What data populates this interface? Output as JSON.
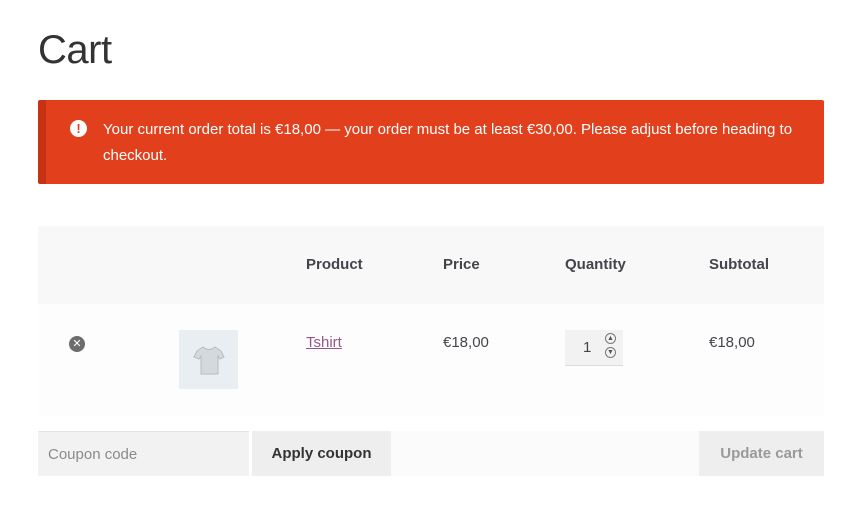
{
  "page": {
    "title": "Cart"
  },
  "notice": {
    "text": "Your current order total is €18,00 — your order must be at least €30,00. Please adjust before heading to checkout.",
    "icon": "exclamation-icon",
    "color": "#e2401c"
  },
  "table": {
    "headers": {
      "product": "Product",
      "price": "Price",
      "quantity": "Quantity",
      "subtotal": "Subtotal"
    },
    "rows": [
      {
        "remove_icon": "remove-x-icon",
        "thumbnail": "tshirt-thumbnail",
        "product": "Tshirt",
        "price": "€18,00",
        "quantity": "1",
        "subtotal": "€18,00"
      }
    ]
  },
  "actions": {
    "coupon_placeholder": "Coupon code",
    "apply_label": "Apply coupon",
    "update_label": "Update cart"
  },
  "colors": {
    "link": "#96588a",
    "error": "#e2401c"
  }
}
